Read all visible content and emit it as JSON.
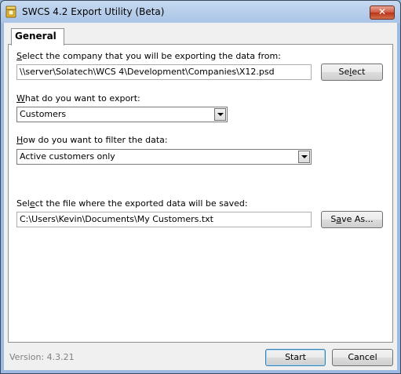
{
  "window": {
    "title": "SWCS 4.2 Export Utility (Beta)",
    "close_glyph": "✕"
  },
  "tabs": [
    {
      "label": "General"
    }
  ],
  "company": {
    "label_pre": "",
    "label_key": "S",
    "label_post": "elect the company that you will be exporting the data from:",
    "path": "\\\\server\\Solatech\\WCS 4\\Development\\Companies\\X12.psd",
    "button_pre": "Se",
    "button_key": "l",
    "button_post": "ect"
  },
  "export": {
    "label_pre": "",
    "label_key": "W",
    "label_post": "hat do you want to export:",
    "selected": "Customers"
  },
  "filter": {
    "label_pre": "",
    "label_key": "H",
    "label_post": "ow do you want to filter the data:",
    "selected": "Active customers only"
  },
  "output": {
    "label_pre": "Sel",
    "label_key": "e",
    "label_post": "ct the file where the exported data will be saved:",
    "path": "C:\\Users\\Kevin\\Documents\\My Customers.txt",
    "button_pre": "S",
    "button_key": "a",
    "button_post": "ve As..."
  },
  "footer": {
    "version": "Version: 4.3.21",
    "start_label": "Start",
    "cancel_label": "Cancel"
  }
}
